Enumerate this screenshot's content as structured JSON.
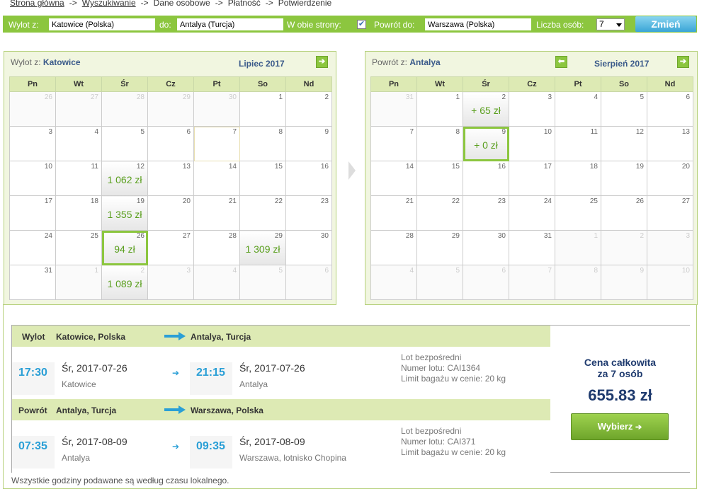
{
  "breadcrumb": {
    "items": [
      "Strona główna",
      "Wyszukiwanie",
      "Dane osobowe",
      "Płatność",
      "Potwierdzenie"
    ],
    "separator": "->"
  },
  "search_bar": {
    "from_label": "Wylot z:",
    "from_value": "Katowice (Polska)",
    "to_label": "do:",
    "to_value": "Antalya (Turcja)",
    "roundtrip_label": "W obie strony:",
    "roundtrip_checked": true,
    "return_label": "Powrót do:",
    "return_value": "Warszawa (Polska)",
    "persons_label": "Liczba osób:",
    "persons_value": "7",
    "change_button": "Zmień"
  },
  "weekdays": [
    "Pn",
    "Wt",
    "Śr",
    "Cz",
    "Pt",
    "So",
    "Nd"
  ],
  "calendars": {
    "outbound": {
      "title_prefix": "Wylot z:",
      "title_city": "Katowice",
      "month": "Lipiec 2017",
      "next_icon": "arrow-right-icon",
      "weeks": [
        [
          {
            "d": "26",
            "o": true
          },
          {
            "d": "27",
            "o": true
          },
          {
            "d": "28",
            "o": true
          },
          {
            "d": "29",
            "o": true
          },
          {
            "d": "30",
            "o": true
          },
          {
            "d": "1"
          },
          {
            "d": "2"
          }
        ],
        [
          {
            "d": "3"
          },
          {
            "d": "4"
          },
          {
            "d": "5"
          },
          {
            "d": "6"
          },
          {
            "d": "7",
            "t": true
          },
          {
            "d": "8"
          },
          {
            "d": "9"
          }
        ],
        [
          {
            "d": "10"
          },
          {
            "d": "11"
          },
          {
            "d": "12",
            "p": "1 062 zł"
          },
          {
            "d": "13"
          },
          {
            "d": "14"
          },
          {
            "d": "15"
          },
          {
            "d": "16"
          }
        ],
        [
          {
            "d": "17"
          },
          {
            "d": "18"
          },
          {
            "d": "19",
            "p": "1 355 zł"
          },
          {
            "d": "20"
          },
          {
            "d": "21"
          },
          {
            "d": "22"
          },
          {
            "d": "23"
          }
        ],
        [
          {
            "d": "24"
          },
          {
            "d": "25"
          },
          {
            "d": "26",
            "p": "94 zł",
            "s": true
          },
          {
            "d": "27"
          },
          {
            "d": "28"
          },
          {
            "d": "29",
            "p": "1 309 zł"
          },
          {
            "d": "30"
          }
        ],
        [
          {
            "d": "31"
          },
          {
            "d": "1",
            "o": true
          },
          {
            "d": "2",
            "o": true,
            "p": "1 089 zł"
          },
          {
            "d": "3",
            "o": true
          },
          {
            "d": "4",
            "o": true
          },
          {
            "d": "5",
            "o": true
          },
          {
            "d": "6",
            "o": true
          }
        ]
      ]
    },
    "return": {
      "title_prefix": "Powrót z:",
      "title_city": "Antalya",
      "month": "Sierpień 2017",
      "prev_icon": "arrow-left-icon",
      "next_icon": "arrow-right-icon",
      "weeks": [
        [
          {
            "d": "31",
            "o": true
          },
          {
            "d": "1"
          },
          {
            "d": "2",
            "p": "+ 65 zł"
          },
          {
            "d": "3"
          },
          {
            "d": "4"
          },
          {
            "d": "5"
          },
          {
            "d": "6"
          }
        ],
        [
          {
            "d": "7"
          },
          {
            "d": "8"
          },
          {
            "d": "9",
            "p": "+ 0 zł",
            "s": true
          },
          {
            "d": "10"
          },
          {
            "d": "11"
          },
          {
            "d": "12"
          },
          {
            "d": "13"
          }
        ],
        [
          {
            "d": "14"
          },
          {
            "d": "15"
          },
          {
            "d": "16"
          },
          {
            "d": "17"
          },
          {
            "d": "18"
          },
          {
            "d": "19"
          },
          {
            "d": "20"
          }
        ],
        [
          {
            "d": "21"
          },
          {
            "d": "22"
          },
          {
            "d": "23"
          },
          {
            "d": "24"
          },
          {
            "d": "25"
          },
          {
            "d": "26"
          },
          {
            "d": "27"
          }
        ],
        [
          {
            "d": "28"
          },
          {
            "d": "29"
          },
          {
            "d": "30"
          },
          {
            "d": "31"
          },
          {
            "d": "1",
            "o": true
          },
          {
            "d": "2",
            "o": true
          },
          {
            "d": "3",
            "o": true
          }
        ],
        [
          {
            "d": "4",
            "o": true
          },
          {
            "d": "5",
            "o": true
          },
          {
            "d": "6",
            "o": true
          },
          {
            "d": "7",
            "o": true
          },
          {
            "d": "8",
            "o": true
          },
          {
            "d": "9",
            "o": true
          },
          {
            "d": "10",
            "o": true
          }
        ]
      ]
    }
  },
  "summary": {
    "outbound": {
      "label": "Wylot",
      "from": "Katowice, Polska",
      "to": "Antalya, Turcja",
      "dep_time": "17:30",
      "dep_date": "Śr, 2017-07-26",
      "dep_place": "Katowice",
      "arr_time": "21:15",
      "arr_date": "Śr, 2017-07-26",
      "arr_place": "Antalya",
      "info": [
        "Lot bezpośredni",
        "Numer lotu: CAI1364",
        "Limit bagażu w cenie: 20 kg"
      ]
    },
    "return": {
      "label": "Powrót",
      "from": "Antalya, Turcja",
      "to": "Warszawa, Polska",
      "dep_time": "07:35",
      "dep_date": "Śr, 2017-08-09",
      "dep_place": "Antalya",
      "arr_time": "09:35",
      "arr_date": "Śr, 2017-08-09",
      "arr_place": "Warszawa, lotnisko Chopina",
      "info": [
        "Lot bezpośredni",
        "Numer lotu: CAI371",
        "Limit bagażu w cenie: 20 kg"
      ]
    },
    "price_label_1": "Cena całkowita",
    "price_label_2": "za 7 osób",
    "price": "655.83 zł",
    "select_button": "Wybierz"
  },
  "footer_note": "Wszystkie godziny podawane są według czasu lokalnego.",
  "colors": {
    "accent": "#8cc63f",
    "navy": "#1e3a6e",
    "time": "#2a9fd6",
    "price_text": "#5a9f1e"
  }
}
